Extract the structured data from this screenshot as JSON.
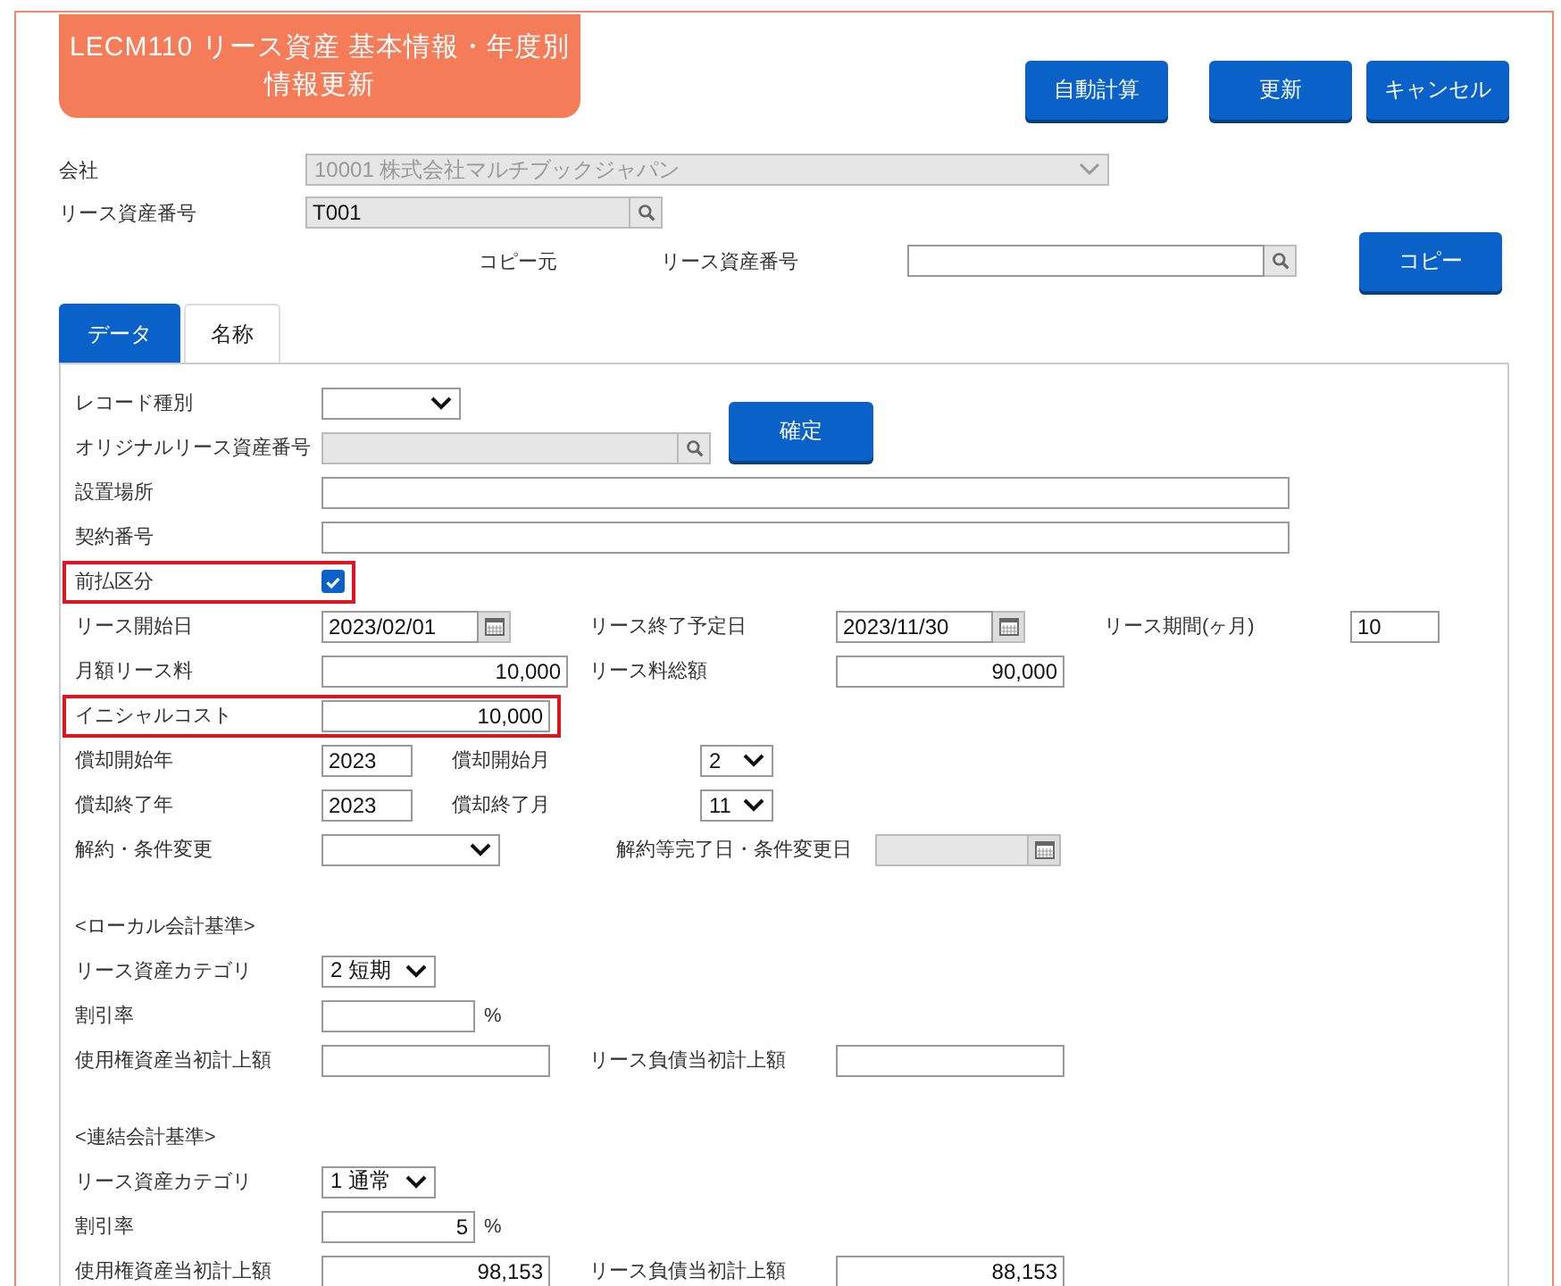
{
  "title": "LECM110 リース資産 基本情報・年度別情報更新",
  "buttons": [
    {
      "label": "自動計算"
    },
    {
      "label": "更新"
    },
    {
      "label": "キャンセル"
    }
  ],
  "company": {
    "label": "会社",
    "value": "10001 株式会社マルチブックジャパン"
  },
  "asset_no": {
    "label": "リース資産番号",
    "value": "T001"
  },
  "copy": {
    "label": "コピー元",
    "field_label": "リース資産番号",
    "button": "コピー"
  },
  "tabs": [
    {
      "label": "データ",
      "selected": true
    },
    {
      "label": "名称",
      "selected": false
    }
  ],
  "form": {
    "record_type": {
      "label": "レコード種別"
    },
    "original_no": {
      "label": "オリジナルリース資産番号"
    },
    "confirm_button": "確定",
    "location": {
      "label": "設置場所"
    },
    "contract_no": {
      "label": "契約番号"
    },
    "prepaid": {
      "label": "前払区分",
      "checked": true,
      "highlighted": true
    },
    "lease_start": {
      "label": "リース開始日",
      "value": "2023/02/01"
    },
    "lease_end": {
      "label": "リース終了予定日",
      "value": "2023/11/30"
    },
    "lease_period": {
      "label": "リース期間(ヶ月)",
      "value": "10"
    },
    "monthly": {
      "label": "月額リース料",
      "value": "10,000"
    },
    "total": {
      "label": "リース料総額",
      "value": "90,000"
    },
    "initial_cost": {
      "label": "イニシャルコスト",
      "value": "10,000",
      "highlighted": true
    },
    "depr_start_year": {
      "label": "償却開始年",
      "value": "2023"
    },
    "depr_start_month": {
      "label": "償却開始月",
      "value": "2"
    },
    "depr_end_year": {
      "label": "償却終了年",
      "value": "2023"
    },
    "depr_end_month": {
      "label": "償却終了月",
      "value": "11"
    },
    "termination": {
      "label": "解約・条件変更"
    },
    "termination_date": {
      "label": "解約等完了日・条件変更日"
    }
  },
  "sections": [
    {
      "heading": "<ローカル会計基準>",
      "category": {
        "label": "リース資産カテゴリ",
        "value": "2 短期"
      },
      "discount": {
        "label": "割引率",
        "unit": "%"
      },
      "rou": {
        "label": "使用権資産当初計上額"
      },
      "liability": {
        "label": "リース負債当初計上額"
      }
    },
    {
      "heading": "<連結会計基準>",
      "category": {
        "label": "リース資産カテゴリ",
        "value": "1 通常"
      },
      "discount": {
        "label": "割引率",
        "value": "5",
        "unit": "%"
      },
      "rou": {
        "label": "使用権資産当初計上額",
        "value": "98,153"
      },
      "liability": {
        "label": "リース負債当初計上額",
        "value": "88,153"
      }
    }
  ]
}
